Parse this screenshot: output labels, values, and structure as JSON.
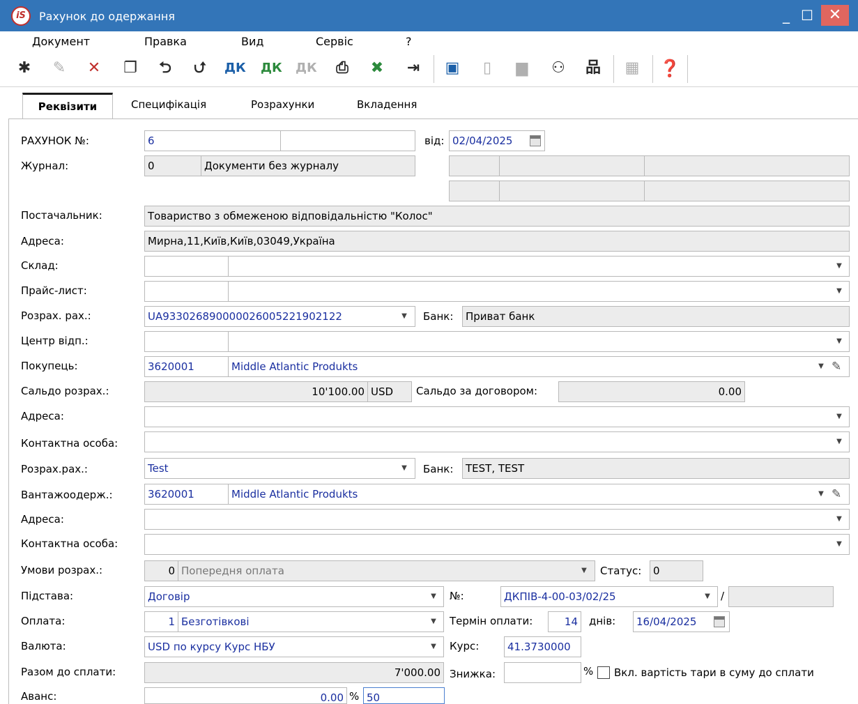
{
  "window": {
    "title": "Рахунок до одержання",
    "logo": "iS"
  },
  "menu": [
    "Документ",
    "Правка",
    "Вид",
    "Сервіс",
    "?"
  ],
  "toolbar_icons": [
    "new-doc-icon",
    "edit-doc-icon",
    "delete-doc-icon",
    "copy-doc-icon",
    "prev-doc-icon",
    "next-doc-icon",
    "dk-blue-icon",
    "dk-green-icon",
    "dk-gray-icon",
    "print-icon",
    "excel-export-icon",
    "exit-icon",
    "save-icon",
    "book-icon",
    "folder-icon",
    "user-link-icon",
    "hierarchy-icon",
    "grid-icon",
    "help-icon"
  ],
  "tabs": [
    "Реквізити",
    "Специфікація",
    "Розрахунки",
    "Вкладення"
  ],
  "form": {
    "invoice_label": "РАХУНОК №:",
    "invoice_no": "6",
    "date_label": "від:",
    "date": "02/04/2025",
    "journal_label": "Журнал:",
    "journal_code": "0",
    "journal_name": "Документи без журналу",
    "supplier_label": "Постачальник:",
    "supplier": "Товариство з обмеженою відповідальністю \"Колос\"",
    "supplier_address_label": "Адреса:",
    "supplier_address": "Мирна,11,Київ,Київ,03049,Україна",
    "warehouse_label": "Склад:",
    "pricelist_label": "Прайс-лист:",
    "account_label": "Розрах. рах.:",
    "account": "UA933026890000026005221902122",
    "bank_label": "Банк:",
    "bank": "Приват банк",
    "center_label": "Центр відп.:",
    "buyer_label": "Покупець:",
    "buyer_code": "3620001",
    "buyer_name": "Middle Atlantic Produkts",
    "balance_label": "Сальдо розрах.:",
    "balance": "10'100.00",
    "balance_currency": "USD",
    "contract_balance_label": "Сальдо за договором:",
    "contract_balance": "0.00",
    "buyer_address_label": "Адреса:",
    "buyer_contact_label": "Контактна особа:",
    "buyer_account_label": "Розрах.рах.:",
    "buyer_account": "Test",
    "buyer_bank_label": "Банк:",
    "buyer_bank": "TEST, TEST",
    "consignee_label": "Вантажоодерж.:",
    "consignee_code": "3620001",
    "consignee_name": "Middle Atlantic Produkts",
    "consignee_address_label": "Адреса:",
    "consignee_contact_label": "Контактна особа:",
    "terms_label": "Умови розрах.:",
    "terms_code": "0",
    "terms_name": "Попередня оплата",
    "status_label": "Статус:",
    "status": "0",
    "basis_label": "Підстава:",
    "basis": "Договір",
    "number_label": "№:",
    "number": "ДКПІВ-4-00-03/02/25",
    "slash": "/",
    "payment_label": "Оплата:",
    "payment_code": "1",
    "payment_name": "Безготівкові",
    "term_label": "Термін оплати:",
    "term_days": "14",
    "days_label": "днів:",
    "due_date": "16/04/2025",
    "currency_label": "Валюта:",
    "currency": "USD по курсу Курс НБУ",
    "rate_label": "Курс:",
    "rate": "41.3730000",
    "total_label": "Разом до сплати:",
    "total": "7'000.00",
    "discount_label": "Знижка:",
    "percent_sign": "%",
    "tare_label": "Вкл. вартість тари в суму до сплати",
    "advance_label": "Аванс:",
    "advance": "0.00",
    "advance_percent_sign": "%",
    "advance_percent": "50"
  }
}
